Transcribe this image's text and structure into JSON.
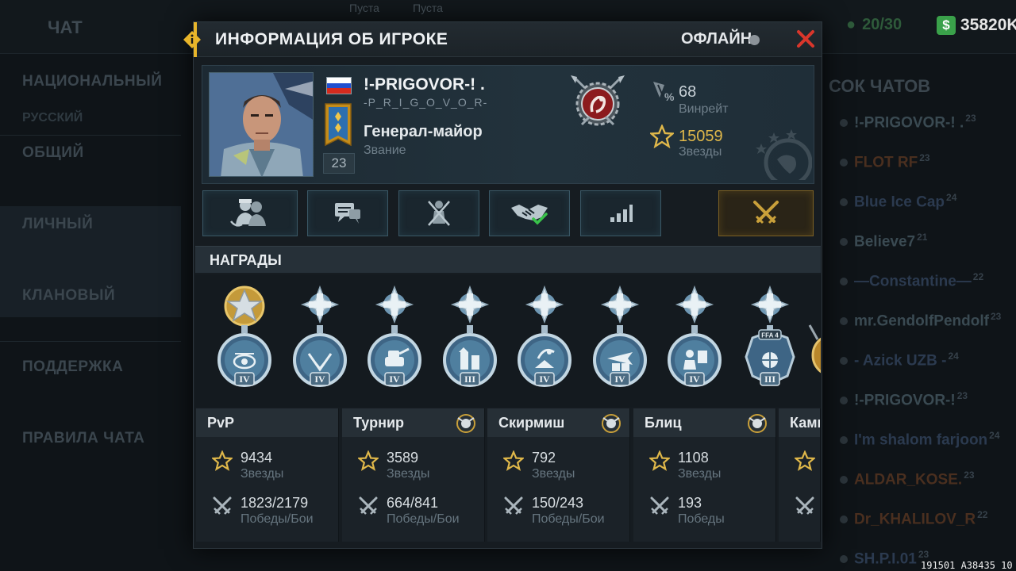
{
  "background": {
    "chat_label": "ЧАТ",
    "tab_empty_1": "Пуста",
    "tab_empty_2": "Пуста",
    "left_menu": {
      "national": "НАЦИОНАЛЬНЫЙ",
      "russian": "РУССКИЙ",
      "general": "ОБЩИЙ",
      "personal": "ЛИЧНЫЙ",
      "clan": "КЛАНОВЫЙ",
      "support": "ПОДДЕРЖКА",
      "rules": "ПРАВИЛА ЧАТА"
    },
    "counter": "20/30",
    "money": "35820K",
    "chat_list_title": "СОК ЧАТОВ",
    "chats": [
      {
        "name": "!-PRIGOVOR-! .",
        "level": "23",
        "color": "#3a4a52"
      },
      {
        "name": "FLOT RF",
        "level": "23",
        "color": "#4a2f1f"
      },
      {
        "name": "Blue Ice Cap",
        "level": "24",
        "color": "#2b3a4f"
      },
      {
        "name": "Believe7",
        "level": "21",
        "color": "#3a4a52"
      },
      {
        "name": "—Constantine—",
        "level": "22",
        "color": "#2b3a4f"
      },
      {
        "name": "mr.GendolfPendolf",
        "level": "23",
        "color": "#3a4a52"
      },
      {
        "name": "- Azick UZB -",
        "level": "24",
        "color": "#2b3a4f"
      },
      {
        "name": "!-PRIGOVOR-!",
        "level": "23",
        "color": "#3a4a52"
      },
      {
        "name": "I'm shalom farjoon",
        "level": "24",
        "color": "#2b3a4f"
      },
      {
        "name": "ALDAR_KOSE.",
        "level": "23",
        "color": "#4a2f1f"
      },
      {
        "name": "Dr_KHALILOV_R",
        "level": "22",
        "color": "#4a2f1f"
      },
      {
        "name": "SH.P.I.01",
        "level": "23",
        "color": "#2b3a4f"
      }
    ],
    "footer_code": "191501 A38435 10"
  },
  "modal": {
    "title": "ИНФОРМАЦИЯ ОБ ИГРОКЕ",
    "status": "ОФЛАЙН",
    "player": {
      "name": "!-PRIGOVOR-! .",
      "tag": "-P_R_I_G_O_V_O_R-",
      "rank": "Генерал-майор",
      "rank_label": "Звание",
      "level": "23",
      "flag": "Russia"
    },
    "stats": {
      "winrate": "68",
      "winrate_label": "Винрейт",
      "stars": "15059",
      "stars_label": "Звезды"
    },
    "actions": [
      "friends",
      "message",
      "block",
      "trade",
      "stats",
      "battle"
    ],
    "awards_title": "НАГРАДЫ",
    "medals": [
      {
        "icon": "eye-medal-icon",
        "grade": "IV",
        "top": "gold-star"
      },
      {
        "icon": "chevron-medal-icon",
        "grade": "IV",
        "top": "silver-cross"
      },
      {
        "icon": "tank-medal-icon",
        "grade": "IV",
        "top": "silver-cross"
      },
      {
        "icon": "fortress-medal-icon",
        "grade": "III",
        "top": "silver-cross"
      },
      {
        "icon": "radar-medal-icon",
        "grade": "IV",
        "top": "silver-cross"
      },
      {
        "icon": "plane-medal-icon",
        "grade": "IV",
        "top": "silver-cross"
      },
      {
        "icon": "soldier-medal-icon",
        "grade": "IV",
        "top": "silver-cross"
      },
      {
        "icon": "ffa-medal-icon",
        "grade": "III",
        "top": "silver-cross",
        "badge": "FFA 4"
      }
    ],
    "modes": [
      {
        "name": "PvP",
        "stars": "9434",
        "stars_label": "Звезды",
        "battles": "1823/2179",
        "battles_label": "Победы/Бои",
        "emblem": false
      },
      {
        "name": "Турнир",
        "stars": "3589",
        "stars_label": "Звезды",
        "battles": "664/841",
        "battles_label": "Победы/Бои",
        "emblem": true
      },
      {
        "name": "Скирмиш",
        "stars": "792",
        "stars_label": "Звезды",
        "battles": "150/243",
        "battles_label": "Победы/Бои",
        "emblem": true
      },
      {
        "name": "Блиц",
        "stars": "1108",
        "stars_label": "Звезды",
        "battles": "193",
        "battles_label": "Победы",
        "emblem": true
      },
      {
        "name": "Камп",
        "stars": "",
        "stars_label": "",
        "battles": "",
        "battles_label": "",
        "emblem": false
      }
    ],
    "colors": {
      "accent": "#e8b52a",
      "gold": "#e0b84a",
      "close": "#d9362b",
      "check": "#39c34a"
    }
  }
}
